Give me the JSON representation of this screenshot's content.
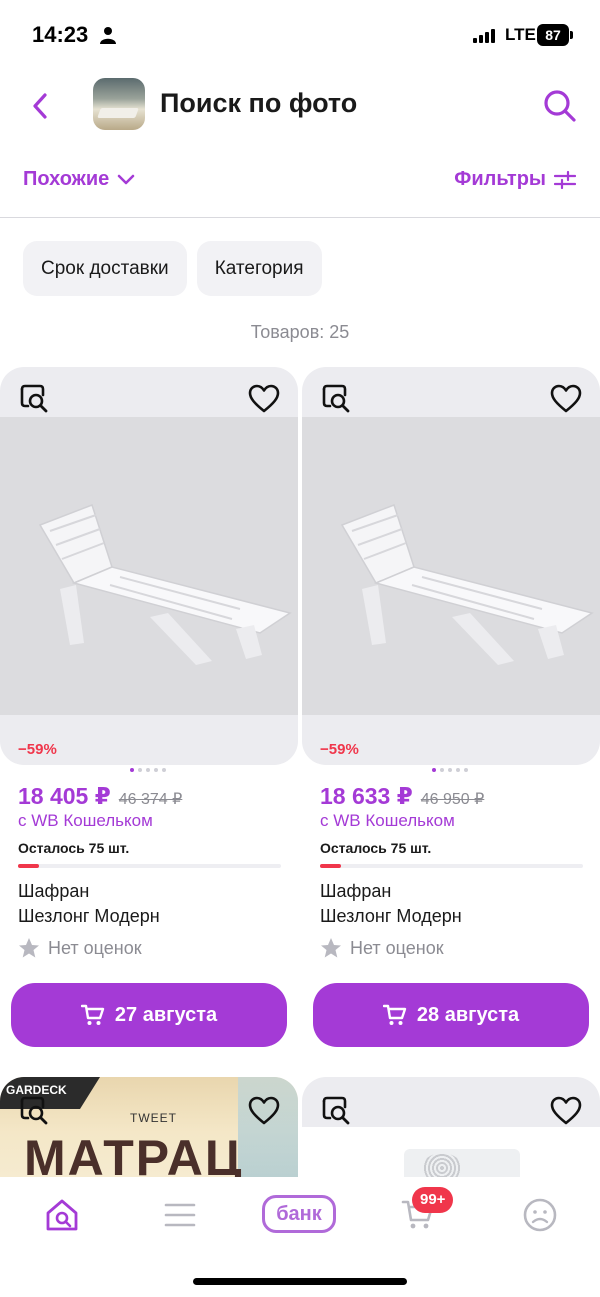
{
  "status_bar": {
    "time": "14:23",
    "network": "LTE",
    "battery": "87"
  },
  "header": {
    "title": "Поиск по фото"
  },
  "toolbar": {
    "sort_label": "Похожие",
    "filter_label": "Фильтры"
  },
  "chips": [
    "Срок доставки",
    "Категория"
  ],
  "results": {
    "count_label": "Товаров: 25"
  },
  "products": [
    {
      "discount": "−59%",
      "price": "18 405 ₽",
      "old_price": "46 374 ₽",
      "wallet": "с WB Кошельком",
      "stock": "Осталось 75 шт.",
      "stock_fraction": 0.08,
      "brand": "Шафран",
      "name": "Шезлонг Модерн",
      "rating": "Нет оценок",
      "delivery": "27 августа"
    },
    {
      "discount": "−59%",
      "price": "18 633 ₽",
      "old_price": "46 950 ₽",
      "wallet": "с WB Кошельком",
      "stock": "Осталось 75 шт.",
      "stock_fraction": 0.08,
      "brand": "Шафран",
      "name": "Шезлонг Модерн",
      "rating": "Нет оценок",
      "delivery": "28 августа"
    }
  ],
  "next_products": [
    {
      "logo": "GARDECK",
      "tag": "TWEET",
      "title": "МАТРАЦ"
    }
  ],
  "bottom_nav": {
    "bank_label": "банк",
    "cart_badge": "99+"
  },
  "colors": {
    "accent": "#a43ad6",
    "discount": "#f0364b",
    "muted": "#8b8b92"
  }
}
